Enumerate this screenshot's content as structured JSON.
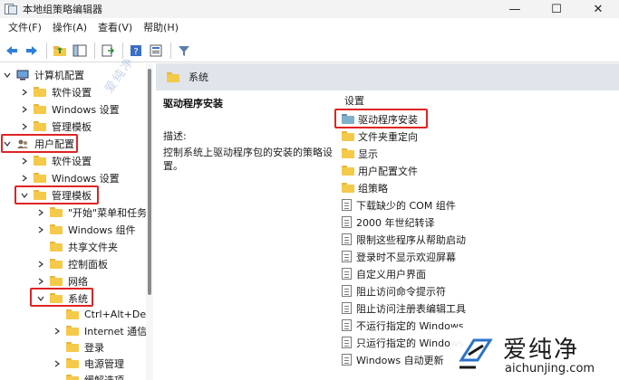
{
  "window": {
    "title": "本地组策略编辑器",
    "minimize": "—",
    "maximize": "☐",
    "close": "✕"
  },
  "menu": [
    "文件(F)",
    "操作(A)",
    "查看(V)",
    "帮助(H)"
  ],
  "tree": {
    "computer_config": "计算机配置",
    "cc_software": "软件设置",
    "cc_windows": "Windows 设置",
    "cc_admin": "管理模板",
    "user_config": "用户配置",
    "uc_software": "软件设置",
    "uc_windows": "Windows 设置",
    "uc_admin": "管理模板",
    "start_menu": "\"开始\"菜单和任务",
    "win_components": "Windows 组件",
    "shared_folders": "共享文件夹",
    "control_panel": "控制面板",
    "network": "网络",
    "system": "系统",
    "ctrl_alt_del": "Ctrl+Alt+De",
    "internet_comm": "Internet 通信",
    "logon": "登录",
    "power_mgmt": "电源管理",
    "cut_row": "缓解选项"
  },
  "right": {
    "header": "系统",
    "desc_title": "驱动程序安装",
    "desc_label": "描述:",
    "desc_text": "控制系统上驱动程序包的安装的策略设置。",
    "settings_header": "设置",
    "items": [
      {
        "label": "驱动程序安装",
        "type": "folder-blue"
      },
      {
        "label": "文件夹重定向",
        "type": "folder"
      },
      {
        "label": "显示",
        "type": "folder"
      },
      {
        "label": "用户配置文件",
        "type": "folder"
      },
      {
        "label": "组策略",
        "type": "folder"
      },
      {
        "label": "下载缺少的 COM 组件",
        "type": "policy"
      },
      {
        "label": "2000 年世纪转译",
        "type": "policy"
      },
      {
        "label": "限制这些程序从帮助启动",
        "type": "policy"
      },
      {
        "label": "登录时不显示欢迎屏幕",
        "type": "policy"
      },
      {
        "label": "自定义用户界面",
        "type": "policy"
      },
      {
        "label": "阻止访问命令提示符",
        "type": "policy"
      },
      {
        "label": "阻止访问注册表编辑工具",
        "type": "policy"
      },
      {
        "label": "不运行指定的 Windows",
        "type": "policy"
      },
      {
        "label": "只运行指定的 Windows",
        "type": "policy"
      },
      {
        "label": "Windows 自动更新",
        "type": "policy"
      }
    ]
  },
  "watermark": {
    "diagonal": "爱纯净",
    "logo_cn": "爱纯净",
    "logo_en": "aichunjing.com"
  },
  "colors": {
    "highlight_box": "#e02424",
    "folder": "#f5c94a",
    "header_bg": "#dfe5ea"
  }
}
